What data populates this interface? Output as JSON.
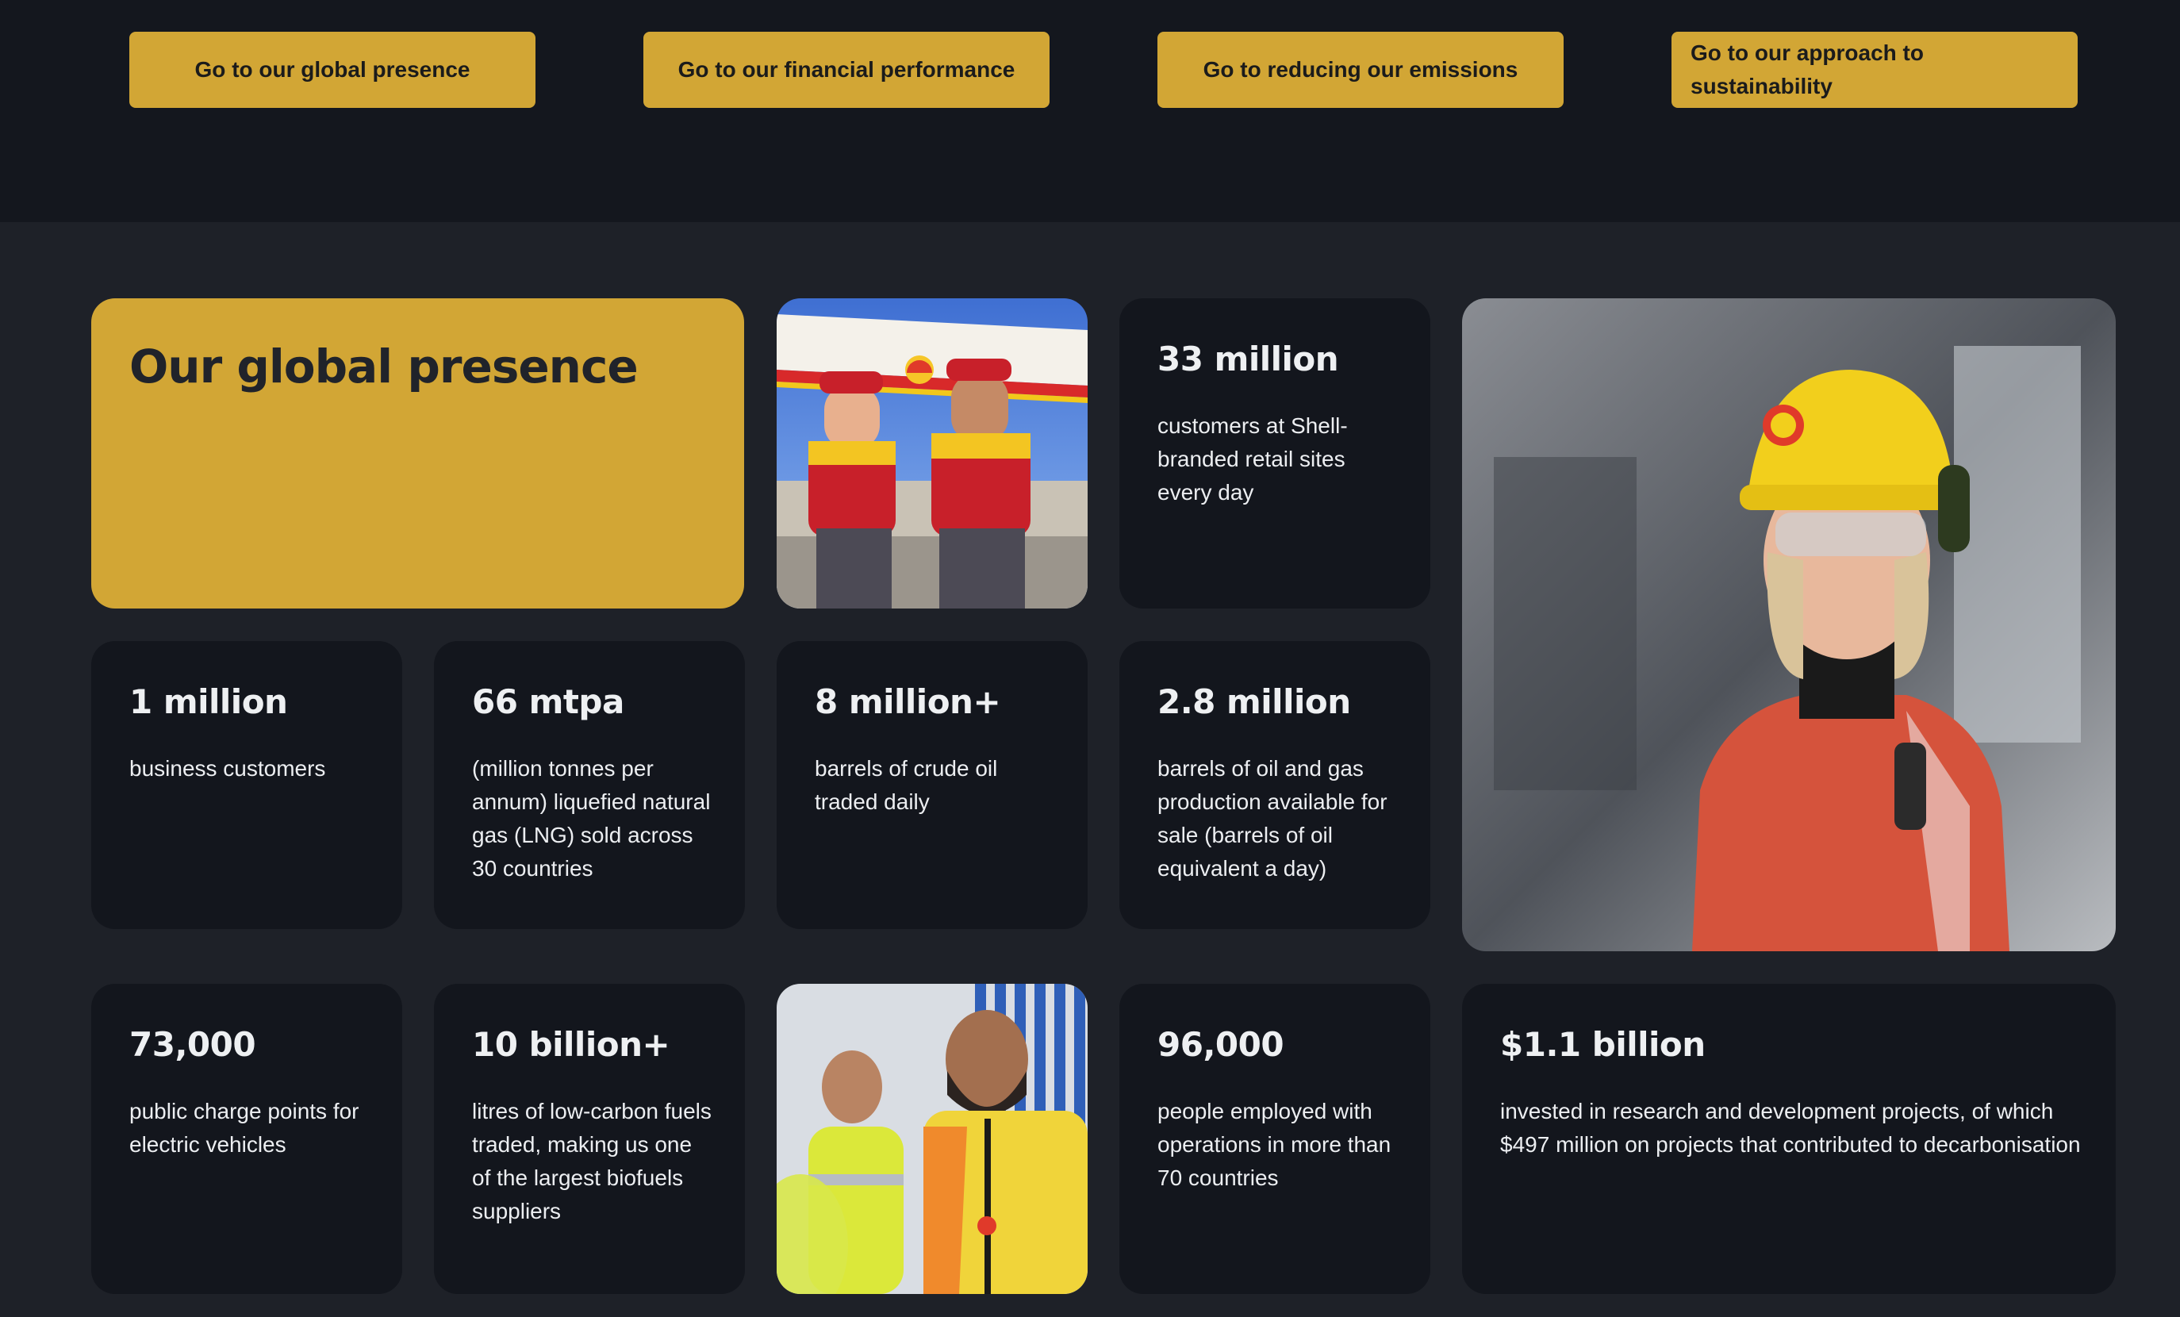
{
  "nav": {
    "buttons": [
      {
        "label": "Go to our global presence"
      },
      {
        "label": "Go to our financial performance"
      },
      {
        "label": "Go to reducing our emissions"
      },
      {
        "label": "Go to our approach to sustainability"
      }
    ]
  },
  "hero": {
    "title": "Our global presence"
  },
  "stats": [
    {
      "value": "33 million",
      "description": "customers at Shell-branded retail sites every day"
    },
    {
      "value": "1 million",
      "description": "business customers"
    },
    {
      "value": "66 mtpa",
      "description": "(million tonnes per annum) liquefied natural gas (LNG) sold across 30 countries"
    },
    {
      "value": "8 million+",
      "description": "barrels of crude oil traded daily"
    },
    {
      "value": "2.8 million",
      "description": "barrels of oil and gas production available for sale (barrels of oil equivalent a day)"
    },
    {
      "value": "73,000",
      "description": "public charge points for electric vehicles"
    },
    {
      "value": "10 billion+",
      "description": "litres of low-carbon fuels traded, making us one of the largest biofuels suppliers"
    },
    {
      "value": "96,000",
      "description": "people employed with operations in more than 70 countries"
    },
    {
      "value": "$1.1 billion",
      "description": "invested in research and development projects, of which $497 million on projects that contributed to decarbonisation"
    }
  ],
  "colors": {
    "accent": "#d2a635",
    "top_band": "#14171e",
    "page_bg": "#1e2128",
    "tile_bg": "#13161d"
  }
}
